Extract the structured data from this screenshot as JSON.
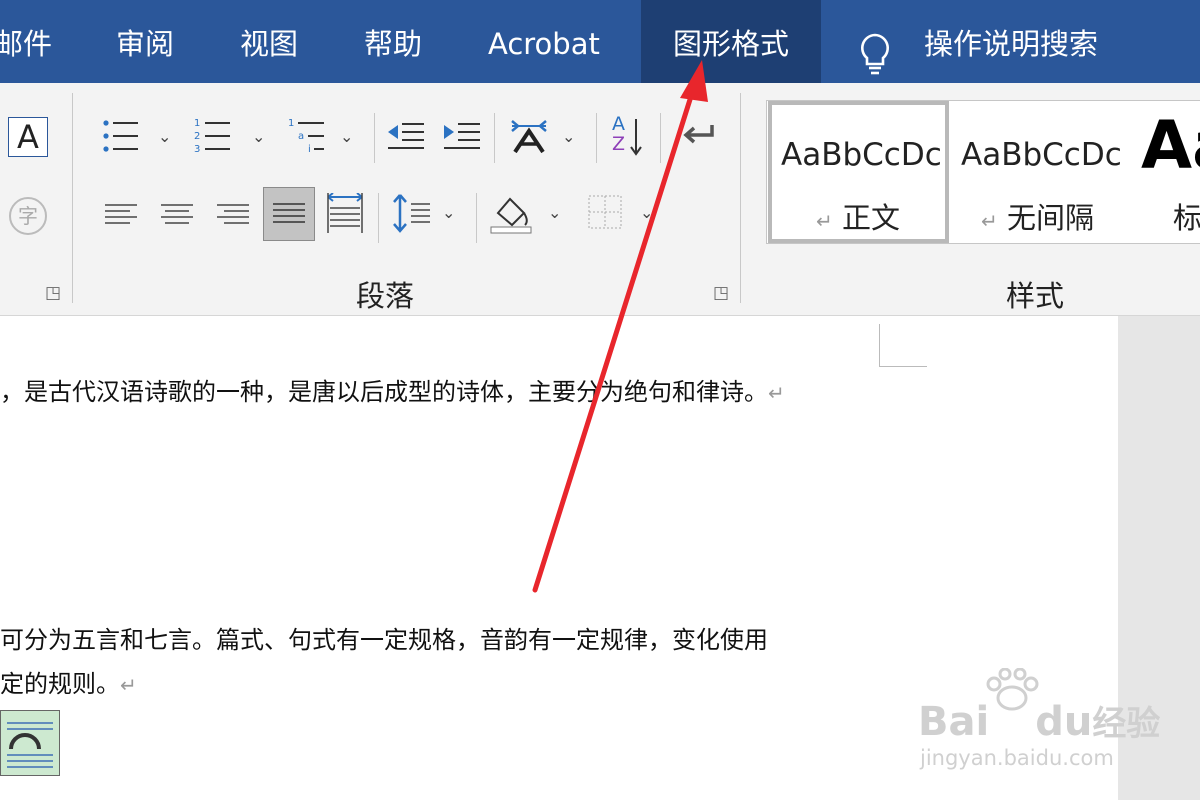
{
  "tabs": [
    "邮件",
    "审阅",
    "视图",
    "帮助",
    "Acrobat",
    "图形格式"
  ],
  "tell_me": "操作说明搜索",
  "ribbon": {
    "paragraph_group_label": "段落",
    "styles_group_label": "样式",
    "font_group": {
      "text_a_glyph": "A",
      "phonetic_glyph": "字"
    },
    "sort_glyph_top": "A",
    "sort_glyph_bottom": "Z"
  },
  "styles": [
    {
      "sample": "AaBbCcDc",
      "name": "正文",
      "selected": true
    },
    {
      "sample": "AaBbCcDc",
      "name": "无间隔",
      "selected": false
    },
    {
      "sample": "Aa",
      "name": "标",
      "selected": false
    }
  ],
  "document": {
    "paragraphs": [
      "，是古代汉语诗歌的一种，是唐以后成型的诗体，主要分为绝句和律诗。",
      "可分为五言和七言。篇式、句式有一定规格，音韵有一定规律，变化使用",
      "定的规则。"
    ],
    "paragraph_mark": "↵"
  },
  "watermark": {
    "brand": "Bai",
    "brand2": "du",
    "word": "经验",
    "url": "jingyan.baidu.com"
  },
  "colors": {
    "tab_bar": "#2b579a",
    "tab_active": "#1e3f73",
    "annotation_arrow": "#e8262c"
  }
}
